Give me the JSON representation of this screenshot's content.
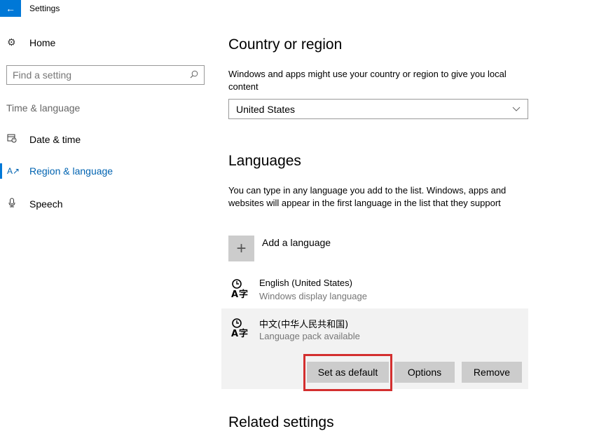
{
  "window": {
    "title": "Settings"
  },
  "icons": {
    "back": "back-arrow-icon",
    "home": "gear-icon",
    "search": "search-icon",
    "date_time": "calendar-clock-icon",
    "region": "region-language-icon",
    "speech": "microphone-icon",
    "add": "plus-icon",
    "language": "language-icon",
    "dropdown": "chevron-down-icon"
  },
  "colors": {
    "accent": "#0078d7",
    "highlight": "#d32f2f",
    "button": "#cccccc"
  },
  "sidebar": {
    "home_label": "Home",
    "search_placeholder": "Find a setting",
    "section_label": "Time & language",
    "items": [
      {
        "label": "Date & time",
        "active": false
      },
      {
        "label": "Region & language",
        "active": true
      },
      {
        "label": "Speech",
        "active": false
      }
    ]
  },
  "main": {
    "country": {
      "heading": "Country or region",
      "description": "Windows and apps might use your country or region to give you local content",
      "selected": "United States"
    },
    "languages": {
      "heading": "Languages",
      "description": "You can type in any language you add to the list. Windows, apps and websites will appear in the first language in the list that they support",
      "add_label": "Add a language",
      "items": [
        {
          "name": "English (United States)",
          "status": "Windows display language"
        },
        {
          "name": "中文(中华人民共和国)",
          "status": "Language pack available"
        }
      ],
      "buttons": {
        "set_default": "Set as default",
        "options": "Options",
        "remove": "Remove"
      }
    },
    "related": {
      "heading": "Related settings"
    }
  }
}
